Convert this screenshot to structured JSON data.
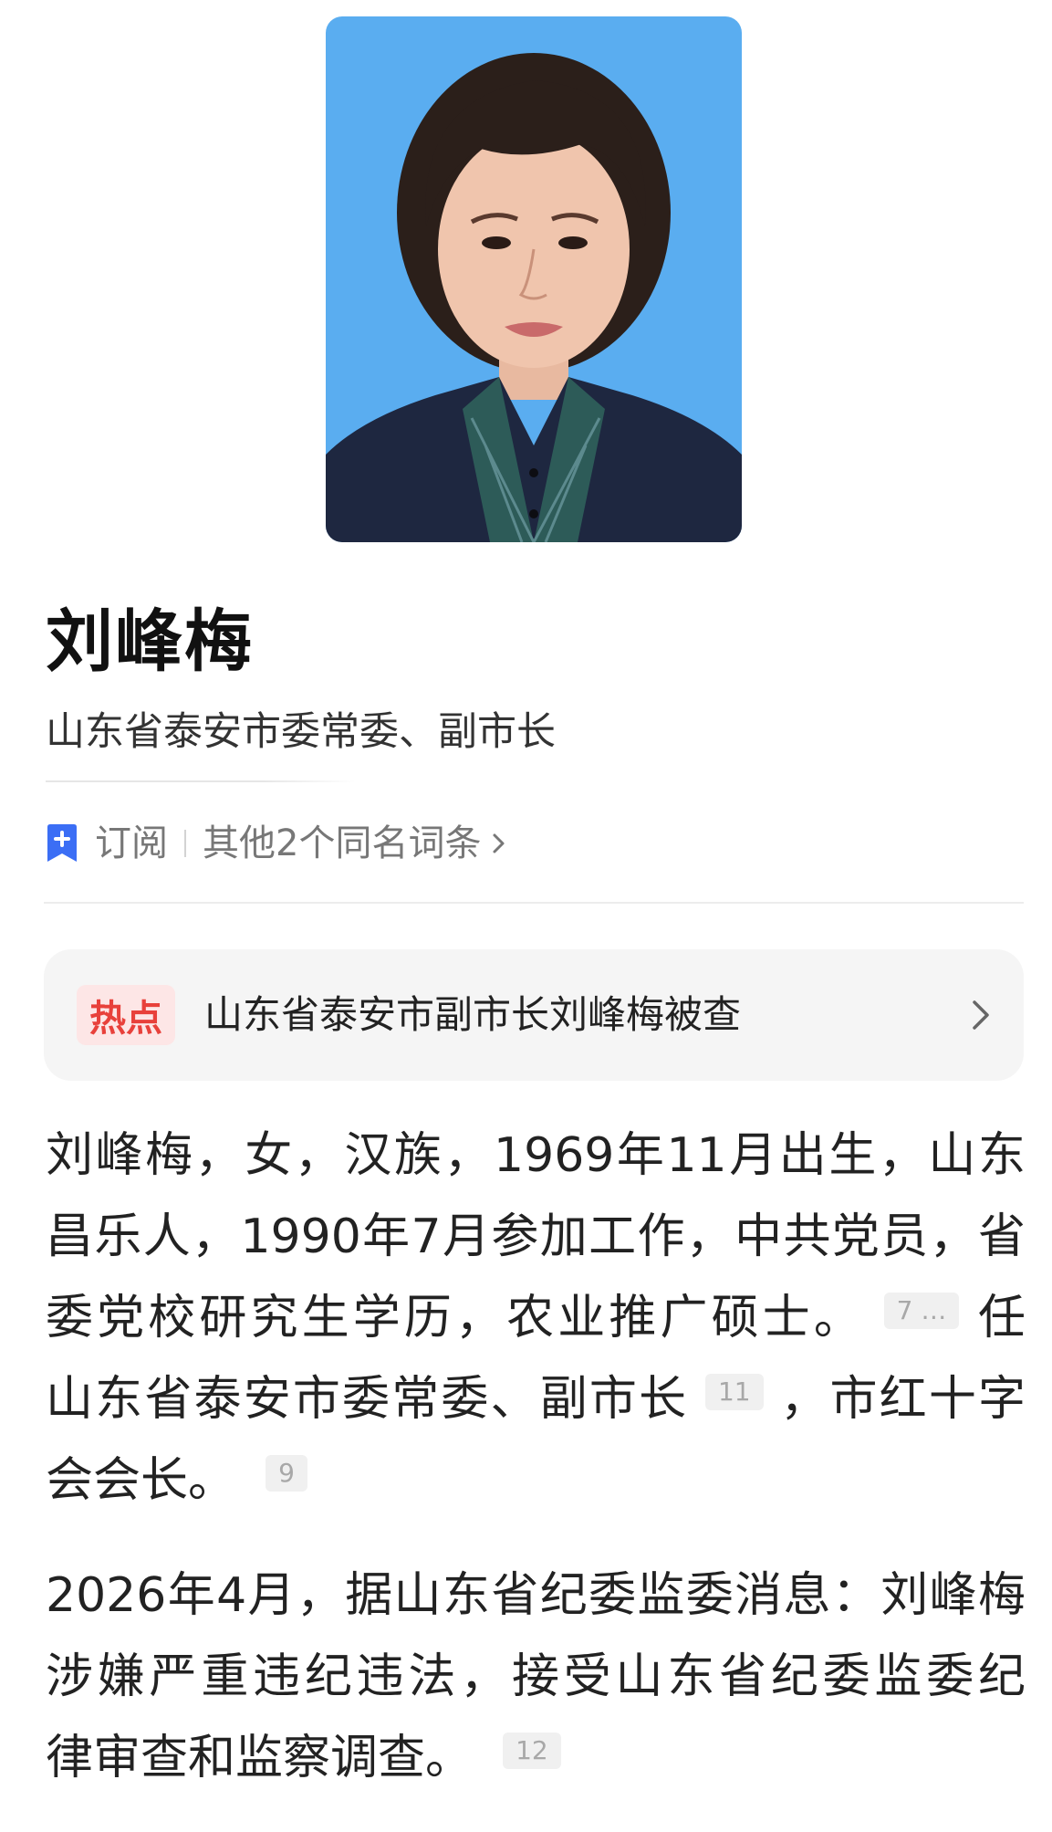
{
  "profile": {
    "name": "刘峰梅",
    "subtitle": "山东省泰安市委常委、副市长"
  },
  "actions": {
    "subscribe_label": "订阅",
    "other_entries_label": "其他2个同名词条"
  },
  "hot": {
    "badge": "热点",
    "title": "山东省泰安市副市长刘峰梅被查"
  },
  "intro": {
    "line1": "刘峰梅，女，汉族，1969年11月出生，山东",
    "line2": "昌乐人，1990年7月参加工作，中共党员，省",
    "line3_text": "委党校研究生学历，农业推广硕士。",
    "line3_cite": "7 …",
    "line3_tail": "任",
    "line4_text": "山东省泰安市委常委、副市长",
    "line4_cite": "11",
    "line4_tail": "，市红十字",
    "line5_text": "会会长。",
    "line5_cite": "9"
  },
  "news": {
    "line1": "2026年4月，据山东省纪委监委消息：刘峰梅",
    "line2": "涉嫌严重违纪违法，接受山东省纪委监委纪",
    "line3_text": "律审查和监察调查。",
    "line3_cite": "12"
  },
  "colors": {
    "accent_blue": "#3b6ef5",
    "hot_red": "#e8413b",
    "hot_bg": "#fde6e6",
    "portrait_bg": "#5aadf0"
  }
}
